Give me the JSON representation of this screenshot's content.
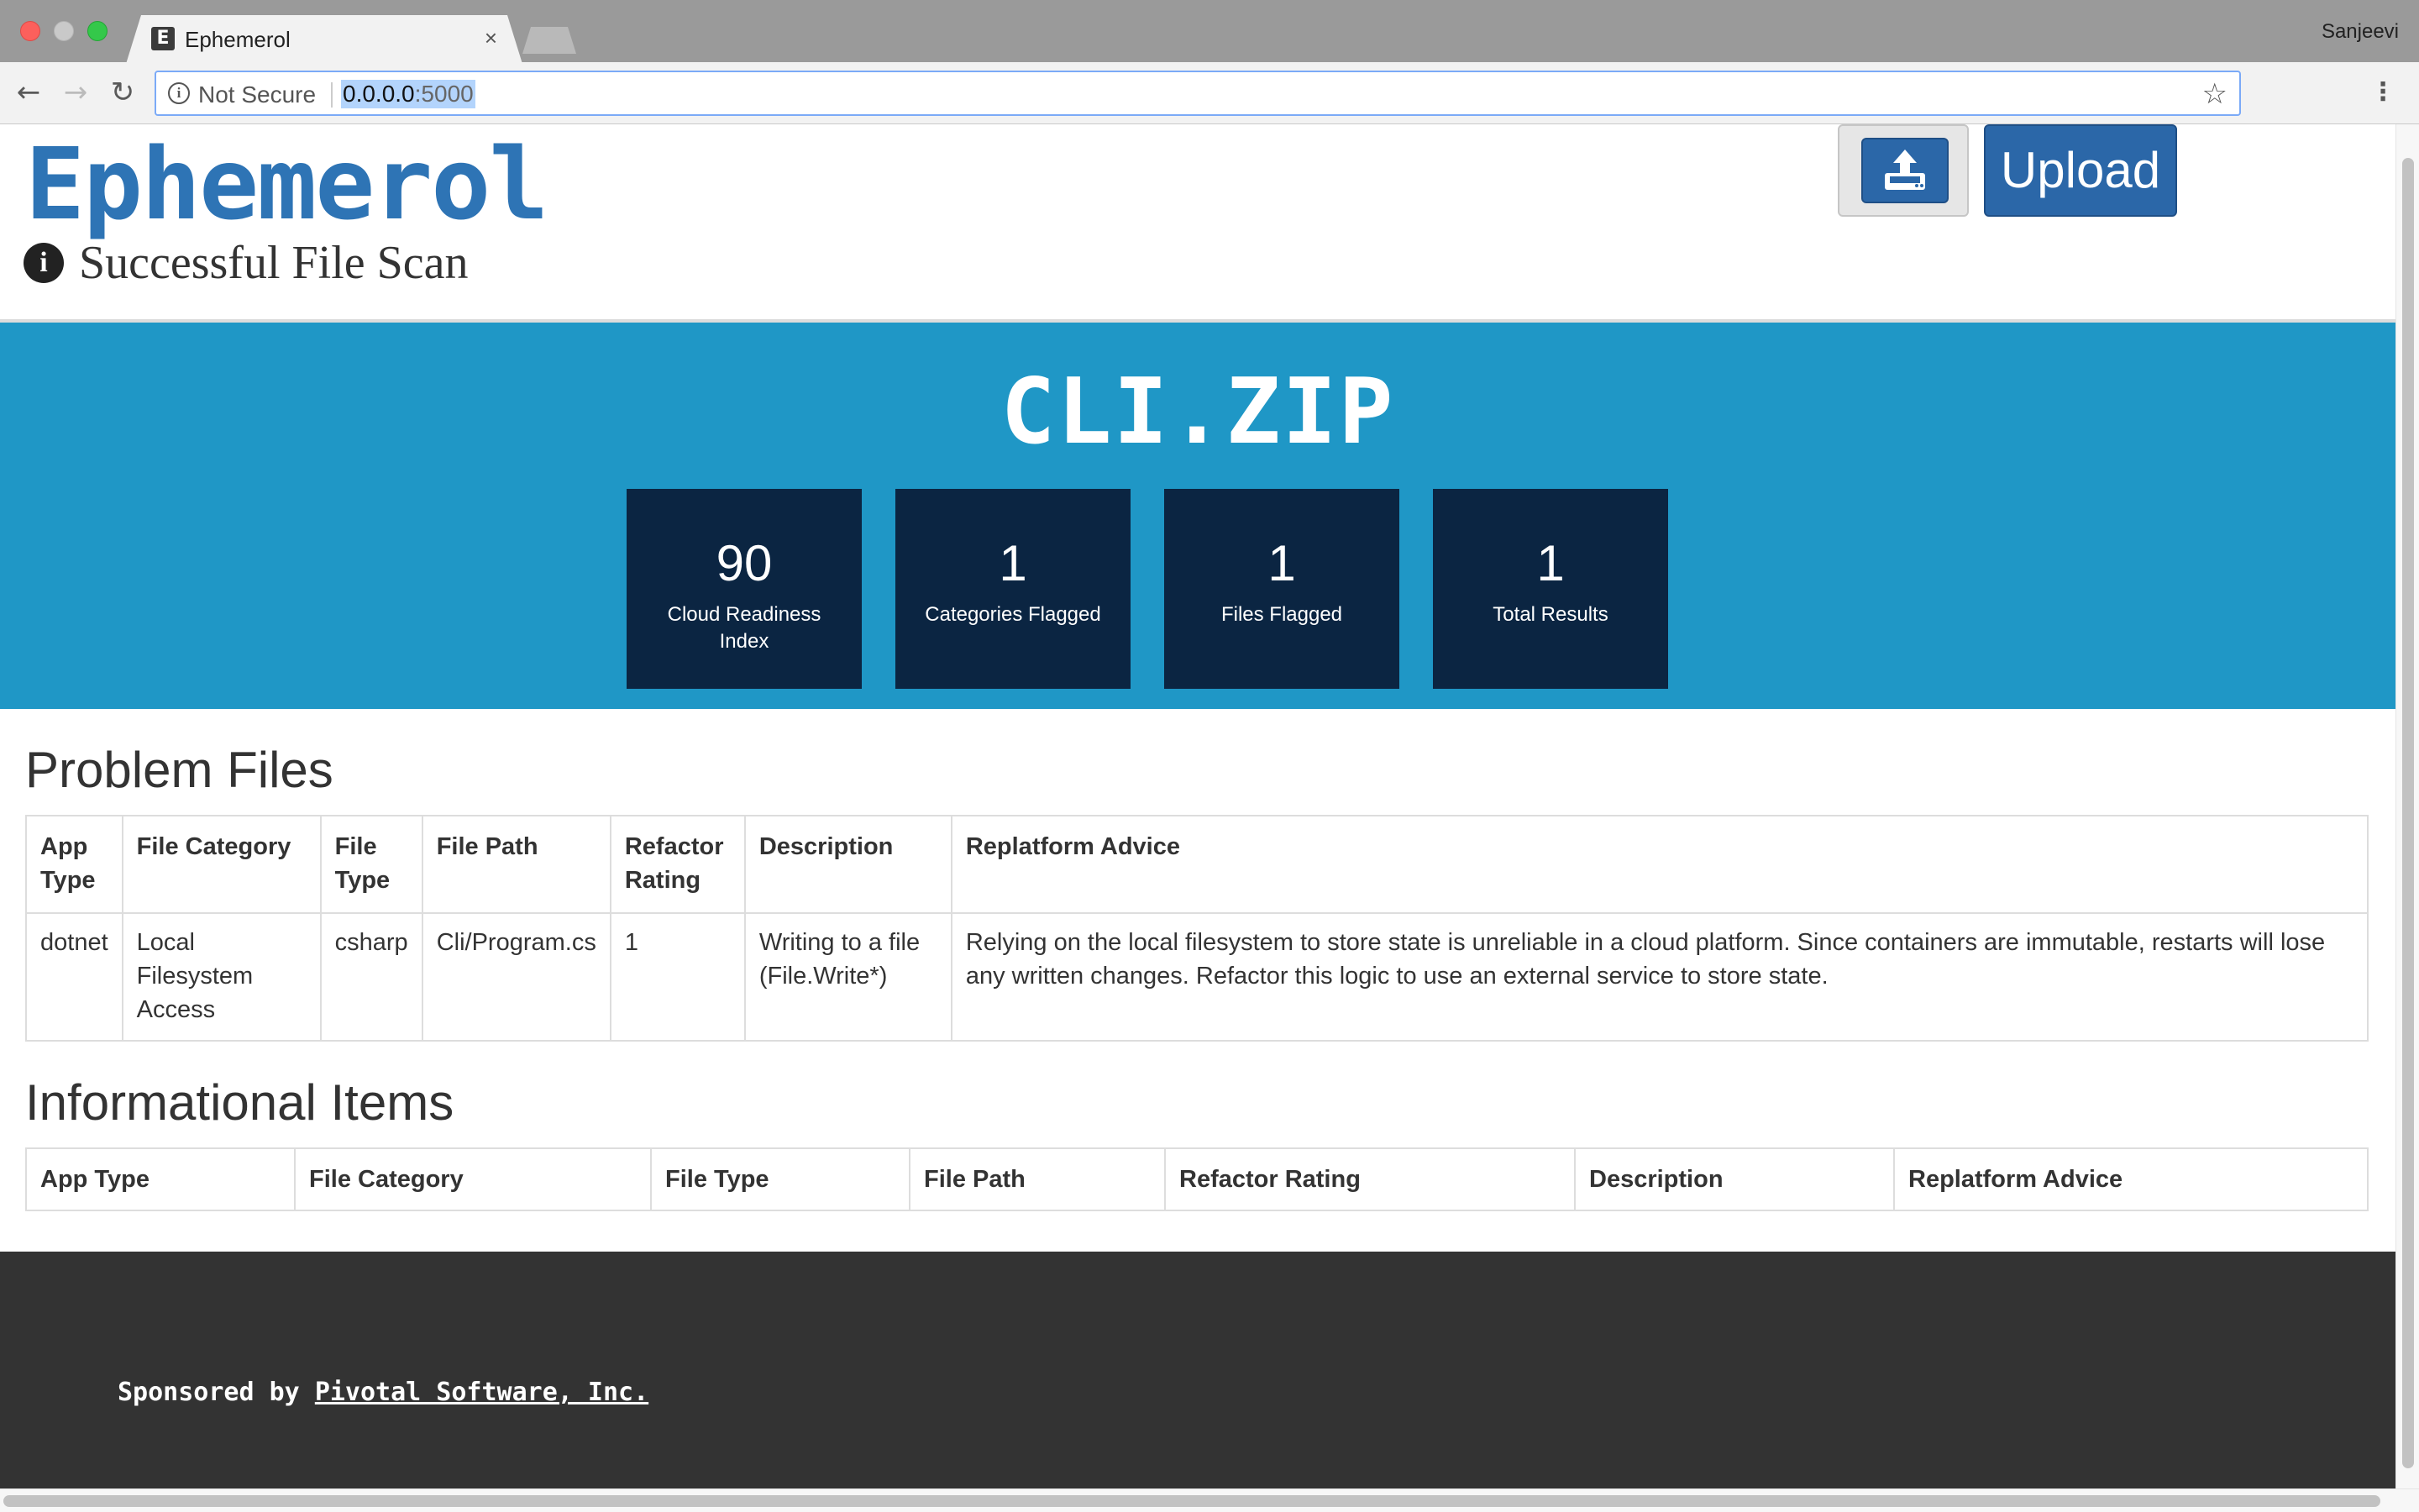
{
  "browser": {
    "tab_favicon": "E",
    "tab_title": "Ephemerol",
    "tab_close": "×",
    "profile_name": "Sanjeevi",
    "security_label": "Not Secure",
    "url_host": "0.0.0.0",
    "url_port": ":5000"
  },
  "header": {
    "brand": "Ephemerol",
    "status_icon": "i",
    "status_message": "Successful File Scan",
    "upload_label": "Upload"
  },
  "banner": {
    "file_name": "CLI.ZIP",
    "stats": [
      {
        "value": "90",
        "label": "Cloud Readiness Index"
      },
      {
        "value": "1",
        "label": "Categories Flagged"
      },
      {
        "value": "1",
        "label": "Files Flagged"
      },
      {
        "value": "1",
        "label": "Total Results"
      }
    ]
  },
  "problem_files": {
    "title": "Problem Files",
    "columns": [
      "App Type",
      "File Category",
      "File Type",
      "File Path",
      "Refactor Rating",
      "Description",
      "Replatform Advice"
    ],
    "rows": [
      [
        "dotnet",
        "Local Filesystem Access",
        "csharp",
        "Cli/Program.cs",
        "1",
        "Writing to a file (File.Write*)",
        "Relying on the local filesystem to store state is unreliable in a cloud platform. Since containers are immutable, restarts will lose any written changes. Refactor this logic to use an external service to store state."
      ]
    ]
  },
  "informational_items": {
    "title": "Informational Items",
    "columns": [
      "App Type",
      "File Category",
      "File Type",
      "File Path",
      "Refactor Rating",
      "Description",
      "Replatform Advice"
    ],
    "rows": []
  },
  "footer": {
    "prefix": "Sponsored by ",
    "link_text": "Pivotal Software, Inc."
  },
  "colors": {
    "brand": "#2e74b5",
    "banner": "#1f97c6",
    "stat_tile": "#0b2542",
    "footer": "#333333",
    "button": "#2b67a8"
  },
  "icons": {
    "status": "info-circle-icon",
    "upload": "upload-tray-icon",
    "back": "back-arrow-icon",
    "forward": "forward-arrow-icon",
    "reload": "reload-icon",
    "bookmark": "star-icon",
    "menu": "vertical-dots-icon"
  }
}
